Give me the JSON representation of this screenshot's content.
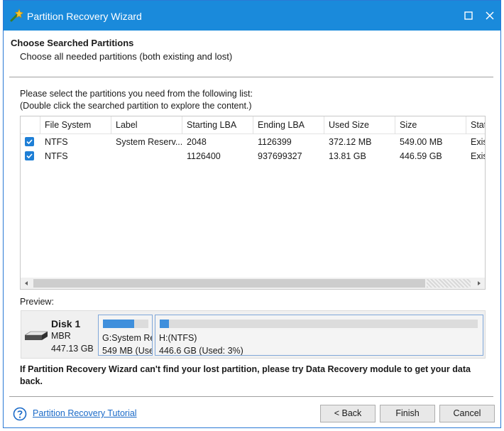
{
  "window": {
    "title": "Partition Recovery Wizard"
  },
  "header": {
    "title": "Choose Searched Partitions",
    "subtitle": "Choose all needed partitions (both existing and lost)"
  },
  "instructions": {
    "line1": "Please select the partitions you need from the following list:",
    "line2": "(Double click the searched partition to explore the content.)"
  },
  "table": {
    "columns": [
      "File System",
      "Label",
      "Starting LBA",
      "Ending LBA",
      "Used Size",
      "Size",
      "Stat"
    ],
    "rows": [
      {
        "checked": true,
        "cells": [
          "NTFS",
          "System Reserv...",
          "2048",
          "1126399",
          "372.12 MB",
          "549.00 MB",
          "Exis"
        ]
      },
      {
        "checked": true,
        "cells": [
          "NTFS",
          "",
          "1126400",
          "937699327",
          "13.81 GB",
          "446.59 GB",
          "Exis"
        ]
      }
    ]
  },
  "preview": {
    "label": "Preview:",
    "disk": {
      "name": "Disk 1",
      "type": "MBR",
      "size": "447.13 GB"
    },
    "partitions": [
      {
        "name": "G:System Re",
        "info": "549 MB (Use",
        "used_fraction": 0.68
      },
      {
        "name": "H:(NTFS)",
        "info": "446.6 GB (Used: 3%)",
        "used_fraction": 0.03
      }
    ]
  },
  "note": "If Partition Recovery Wizard can't find your lost partition, please try Data Recovery module to get your data back.",
  "footer": {
    "tutorial_link": "Partition Recovery Tutorial",
    "back_label": "< Back",
    "finish_label": "Finish",
    "cancel_label": "Cancel"
  },
  "colors": {
    "titlebar": "#1a8adb",
    "accent": "#1e7fd6",
    "link": "#1a6ac8"
  }
}
